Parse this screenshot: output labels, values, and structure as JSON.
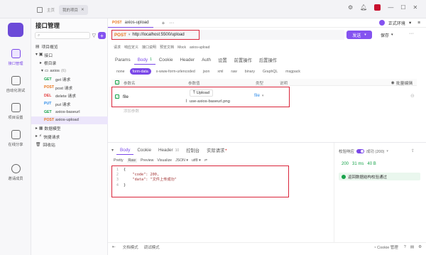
{
  "titlebar": {
    "home": "主页",
    "project_tab": "我的项目"
  },
  "rail": [
    {
      "label": "接口管理",
      "icon": "api-icon",
      "active": true
    },
    {
      "label": "自动化测试",
      "icon": "auto-test-icon",
      "active": false
    },
    {
      "label": "项目设置",
      "icon": "settings-icon",
      "active": false
    },
    {
      "label": "在线分享",
      "icon": "share-icon",
      "active": false
    },
    {
      "label": "邀请成员",
      "icon": "invite-icon",
      "active": false
    }
  ],
  "tree": {
    "title": "接口管理",
    "search_placeholder": "",
    "overview": "项目概览",
    "api_group": "接口",
    "root": "根目录",
    "folder": "axios",
    "folder_count": "(6)",
    "items": [
      {
        "method": "GET",
        "name": "get 请求"
      },
      {
        "method": "POST",
        "name": "post 请求"
      },
      {
        "method": "DEL",
        "name": "delete 请求"
      },
      {
        "method": "PUT",
        "name": "put 请求"
      },
      {
        "method": "GET",
        "name": "axios-baseurl"
      },
      {
        "method": "POST",
        "name": "axios-upload"
      }
    ],
    "data_model": "数据模型",
    "quick_request": "快捷请求",
    "recycle": "回收站"
  },
  "editor": {
    "doc_tab": "axios-upload",
    "env": "正式环境",
    "method": "POST",
    "url": "http://localhost:5500/upload",
    "send": "发送",
    "save": "保存",
    "breadcrumbs": [
      "请求",
      "响应定义",
      "接口说明",
      "预览文档",
      "Mock",
      "axios-upload"
    ],
    "req_tabs": [
      "Params",
      "Body",
      "Cookie",
      "Header",
      "Auth",
      "设置",
      "前置操作",
      "后置操作"
    ],
    "body_count": "1",
    "body_types": [
      "none",
      "form-data",
      "x-www-form-urlencoded",
      "json",
      "xml",
      "raw",
      "binary",
      "GraphQL",
      "msgpack"
    ],
    "table_headers": [
      "参数名",
      "参数值",
      "类型",
      "说明"
    ],
    "bulk_edit": "批量编辑",
    "param_name": "file",
    "upload_label": "Upload",
    "file_name": "use-axios-baseurl.png",
    "param_type": "file",
    "add_param": "添加参数"
  },
  "response": {
    "tabs": [
      "Body",
      "Cookie",
      "Header",
      "控制台",
      "实际请求"
    ],
    "header_count": "10",
    "view_modes": [
      "Pretty",
      "Raw",
      "Preview",
      "Visualize",
      "JSON",
      "utf8"
    ],
    "code_lines": [
      "{",
      "    \"code\": 200,",
      "    \"data\": \"文件上传成功\"",
      "}"
    ],
    "validate_label": "校验响应",
    "status_text": "成功 (200)",
    "status_code": "200",
    "time": "31 ms",
    "size": "40 B",
    "validate_result": "返回数据结构校验通过"
  },
  "statusbar": {
    "doc_mode": "文档模式",
    "debug_mode": "调试模式",
    "cookie": "Cookie 管理"
  },
  "colors": {
    "accent": "#7a47e8",
    "highlight": "#d9243a",
    "success": "#17a34a"
  }
}
